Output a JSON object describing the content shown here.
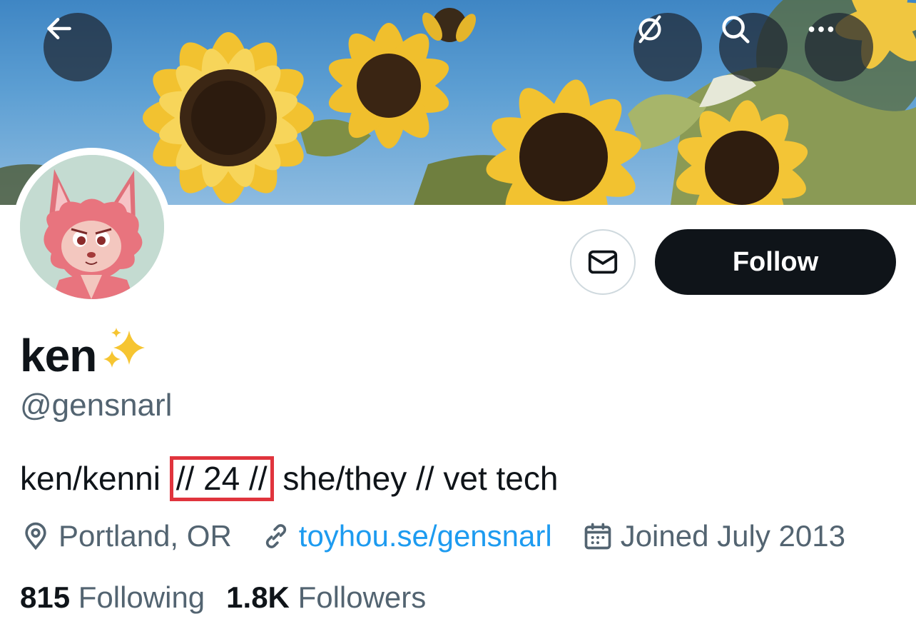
{
  "header": {
    "back_icon": "arrow-left-icon",
    "actions": [
      "eye-slash-icon",
      "search-icon",
      "more-icon"
    ]
  },
  "profile": {
    "display_name": "ken",
    "name_emoji": "✨",
    "handle": "@gensnarl",
    "bio_before": "ken/kenni ",
    "bio_highlight": "// 24 //",
    "bio_after": " she/they // vet tech",
    "location": "Portland, OR",
    "website": "toyhou.se/gensnarl",
    "joined": "Joined July 2013"
  },
  "actions": {
    "message_icon": "envelope-icon",
    "follow_label": "Follow"
  },
  "stats": {
    "following_count": "815",
    "following_label": "Following",
    "followers_count": "1.8K",
    "followers_label": "Followers"
  },
  "colors": {
    "text_primary": "#0f1419",
    "text_secondary": "#536471",
    "link": "#1d9bf0",
    "highlight_box": "#e0343d",
    "follow_bg": "#0f1419"
  }
}
